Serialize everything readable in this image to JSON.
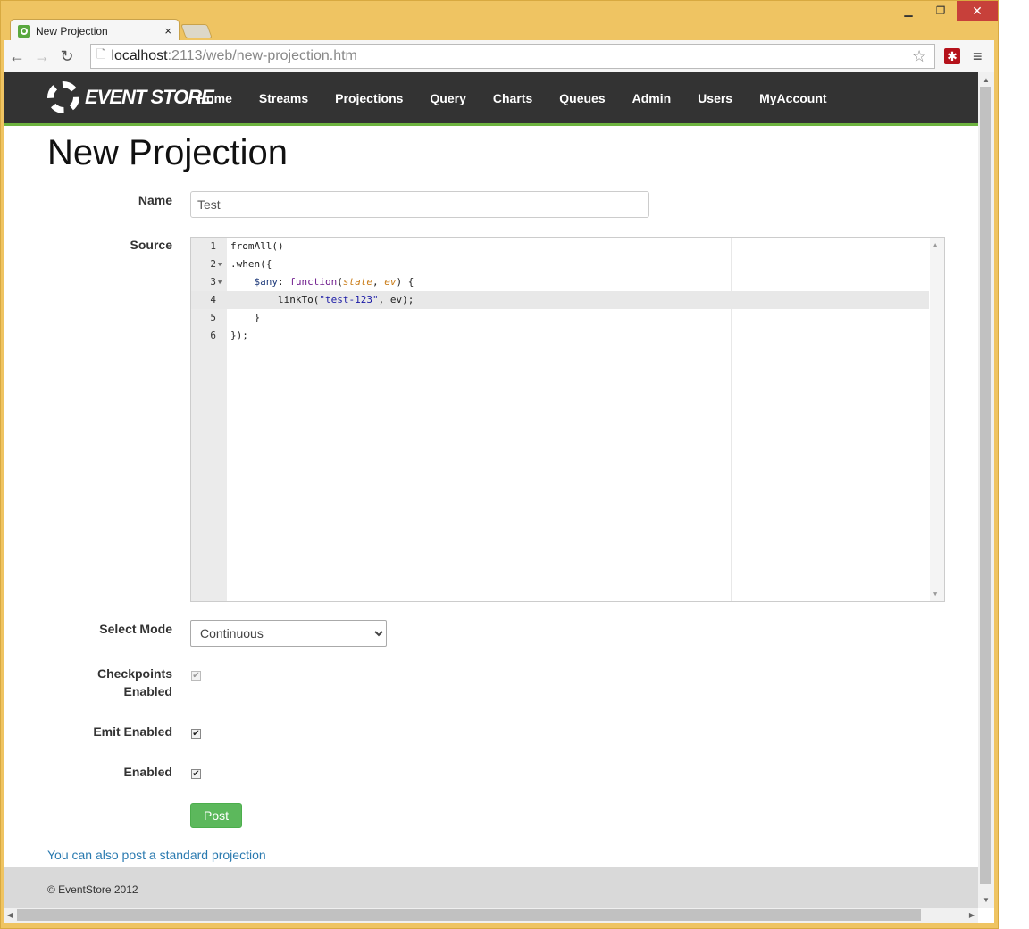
{
  "browser": {
    "tab_title": "New Projection",
    "tab_close": "×",
    "url_host": "localhost",
    "url_rest": ":2113/web/new-projection.htm"
  },
  "nav": {
    "logo": "EVENT STORE",
    "items": [
      "Home",
      "Streams",
      "Projections",
      "Query",
      "Charts",
      "Queues",
      "Admin",
      "Users",
      "MyAccount"
    ]
  },
  "page": {
    "title": "New Projection",
    "name_label": "Name",
    "name_value": "Test",
    "source_label": "Source",
    "source_lines": [
      "fromAll()",
      ".when({",
      "    $any: function(state, ev) {",
      "        linkTo(\"test-123\", ev);",
      "    }",
      "});"
    ],
    "line_numbers": [
      "1",
      "2",
      "3",
      "4",
      "5",
      "6"
    ],
    "mode_label": "Select Mode",
    "mode_value": "Continuous",
    "checkpoints_label_1": "Checkpoints",
    "checkpoints_label_2": "Enabled",
    "checkpoints_checked": true,
    "emit_label": "Emit Enabled",
    "emit_checked": true,
    "enabled_label": "Enabled",
    "enabled_checked": true,
    "post_label": "Post",
    "standard_link": "You can also post a standard projection"
  },
  "footer": {
    "text": "© EventStore 2012"
  },
  "colors": {
    "nav_bg": "#333333",
    "accent_green": "#6db33f",
    "post_button": "#5cb85c",
    "link": "#2a7ab0",
    "frame": "#efc462"
  }
}
